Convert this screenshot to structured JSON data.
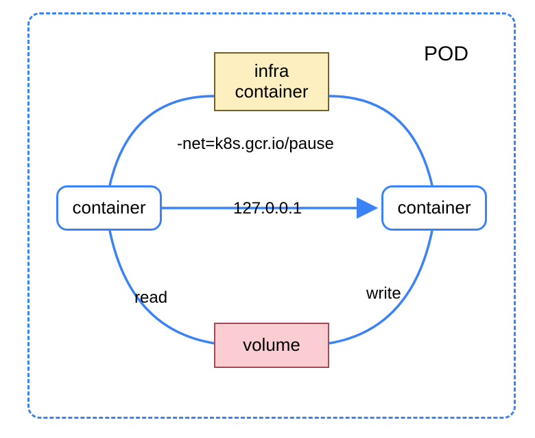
{
  "pod": {
    "title": "POD"
  },
  "nodes": {
    "infra": "infra\ncontainer",
    "left": "container",
    "right": "container",
    "volume": "volume"
  },
  "edges": {
    "net": "-net=k8s.gcr.io/pause",
    "mid": "127.0.0.1",
    "read": "read",
    "write": "write"
  }
}
